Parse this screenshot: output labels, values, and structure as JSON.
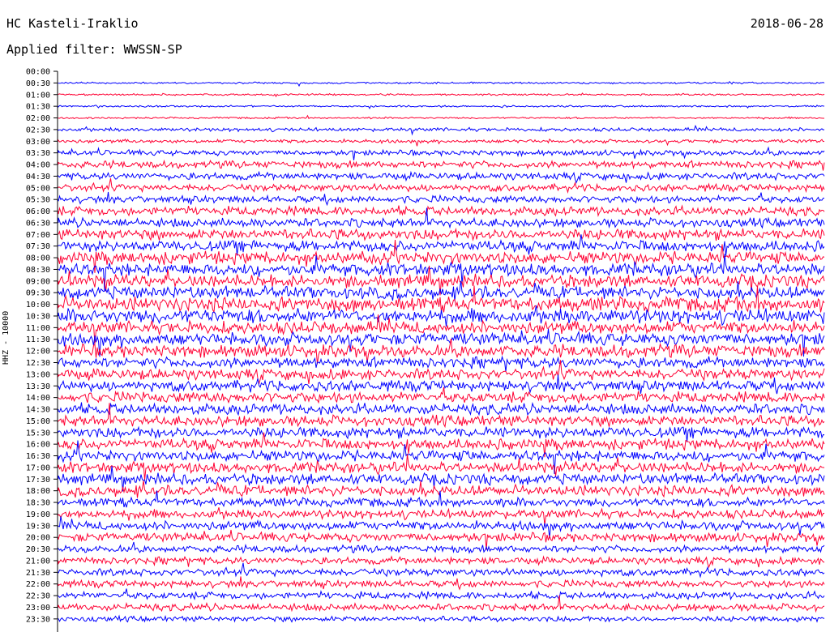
{
  "header": {
    "station": "HC Kasteli-Iraklio",
    "date": "2018-06-28",
    "filter": "Applied filter: WWSSN-SP"
  },
  "chart_data": {
    "type": "line",
    "ylabel": "HHZ - 10000",
    "time_labels": [
      "00:00",
      "00:30",
      "01:00",
      "01:30",
      "02:00",
      "02:30",
      "03:00",
      "03:30",
      "04:00",
      "04:30",
      "05:00",
      "05:30",
      "06:00",
      "06:30",
      "07:00",
      "07:30",
      "08:00",
      "08:30",
      "09:00",
      "09:30",
      "10:00",
      "10:30",
      "11:00",
      "11:30",
      "12:00",
      "12:30",
      "13:00",
      "13:30",
      "14:00",
      "14:30",
      "15:00",
      "15:30",
      "16:00",
      "16:30",
      "17:00",
      "17:30",
      "18:00",
      "18:30",
      "19:00",
      "19:30",
      "20:00",
      "20:30",
      "21:00",
      "21:30",
      "22:00",
      "22:30",
      "23:00",
      "23:30"
    ],
    "row_amplitude": [
      0,
      1,
      1,
      1,
      1,
      2,
      2,
      3,
      4,
      4,
      4,
      4,
      5,
      5,
      6,
      6,
      7,
      7,
      7,
      7,
      8,
      8,
      7,
      7,
      7,
      6,
      6,
      6,
      6,
      6,
      6,
      6,
      6,
      6,
      6,
      6,
      6,
      5,
      5,
      5,
      5,
      4,
      4,
      4,
      4,
      4,
      4,
      3
    ],
    "colors": {
      "odd": "#0000ff",
      "even": "#ff0033"
    }
  }
}
